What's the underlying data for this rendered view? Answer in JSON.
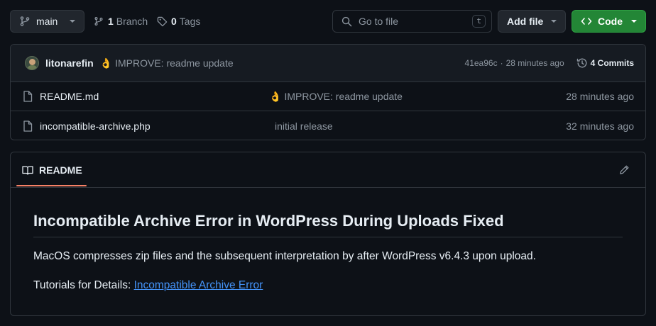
{
  "branch": {
    "name": "main",
    "branch_count": "1",
    "branch_label": "Branch",
    "tag_count": "0",
    "tag_label": "Tags"
  },
  "search": {
    "placeholder": "Go to file",
    "shortcut": "t"
  },
  "actions": {
    "add_file": "Add file",
    "code": "Code"
  },
  "commit": {
    "author": "litonarefin",
    "emoji": "👌",
    "message": "IMPROVE: readme update",
    "hash": "41ea96c",
    "separator": "·",
    "time": "28 minutes ago",
    "commits_label": "4 Commits"
  },
  "files": [
    {
      "name": "README.md",
      "emoji": "👌",
      "message": "IMPROVE: readme update",
      "time": "28 minutes ago"
    },
    {
      "name": "incompatible-archive.php",
      "emoji": "",
      "message": "initial release",
      "time": "32 minutes ago"
    }
  ],
  "readme": {
    "tab_label": "README",
    "heading": "Incompatible Archive Error in WordPress During Uploads Fixed",
    "paragraph": "MacOS compresses zip files and the subsequent interpretation by after WordPress v6.4.3 upon upload.",
    "tutorial_prefix": "Tutorials for Details:",
    "tutorial_link": "Incompatible Archive Error"
  },
  "colors": {
    "accent_green": "#238636",
    "link": "#4493f8",
    "tab_underline": "#f78166",
    "background": "#0d1117"
  }
}
